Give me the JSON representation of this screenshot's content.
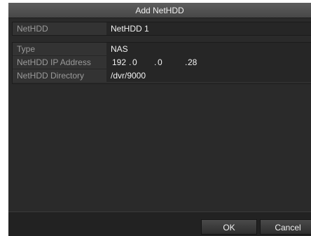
{
  "dialog": {
    "title": "Add NetHDD"
  },
  "netHDD": {
    "label": "NetHDD",
    "value": "NetHDD 1"
  },
  "fields": {
    "type_label": "Type",
    "type_value": "NAS",
    "ip_label": "NetHDD IP Address",
    "ip_octets": [
      "192",
      "0",
      "0",
      "28"
    ],
    "ip_dot": ".",
    "dir_label": "NetHDD Directory",
    "dir_value": "/dvr/9000"
  },
  "buttons": {
    "ok": "OK",
    "cancel": "Cancel"
  }
}
